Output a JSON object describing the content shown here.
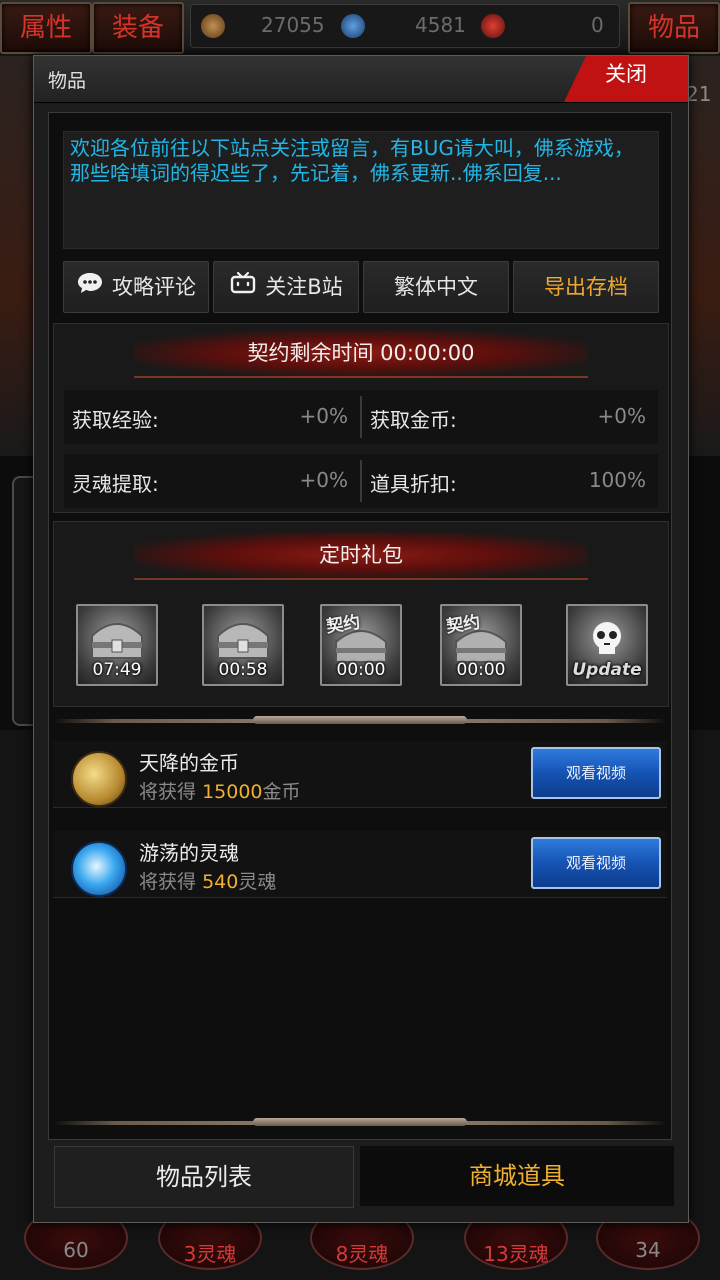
{
  "top_bar": {
    "tab_attributes": "属性",
    "tab_equipment": "装备",
    "tab_items": "物品",
    "currency_1": "27055",
    "currency_2": "4581",
    "currency_3": "0"
  },
  "background": {
    "right_number": "21",
    "bottom_buttons": [
      {
        "label": "60"
      },
      {
        "label": "3灵魂"
      },
      {
        "label": "8灵魂"
      },
      {
        "label": "13灵魂"
      },
      {
        "label": "34"
      }
    ]
  },
  "modal": {
    "title": "物品",
    "close_label": "关闭",
    "notice": "欢迎各位前往以下站点关注或留言，有BUG请大叫，佛系游戏，那些啥填词的得迟些了，先记着，佛系更新..佛系回复...",
    "buttons": {
      "guide_comments": "攻略评论",
      "follow_bilibili": "关注B站",
      "traditional_chinese": "繁体中文",
      "export_save": "导出存档"
    },
    "contract": {
      "title": "契约剩余时间 00:00:00",
      "stats": [
        {
          "label": "获取经验:",
          "value": "+0%"
        },
        {
          "label": "获取金币:",
          "value": "+0%"
        },
        {
          "label": "灵魂提取:",
          "value": "+0%"
        },
        {
          "label": "道具折扣:",
          "value": "100%"
        }
      ]
    },
    "timed_gifts": {
      "title": "定时礼包",
      "items": [
        {
          "time": "07:49",
          "tag": ""
        },
        {
          "time": "00:58",
          "tag": ""
        },
        {
          "time": "00:00",
          "tag": "契约"
        },
        {
          "time": "00:00",
          "tag": "契约"
        },
        {
          "time": "",
          "tag": "Update"
        }
      ]
    },
    "rewards": [
      {
        "name": "天降的金币",
        "desc_prefix": "将获得",
        "amount": "15000",
        "unit": "金币",
        "button": "观看视频"
      },
      {
        "name": "游荡的灵魂",
        "desc_prefix": "将获得",
        "amount": "540",
        "unit": "灵魂",
        "button": "观看视频"
      }
    ],
    "tabs": {
      "item_list": "物品列表",
      "shop_items": "商城道具"
    }
  }
}
